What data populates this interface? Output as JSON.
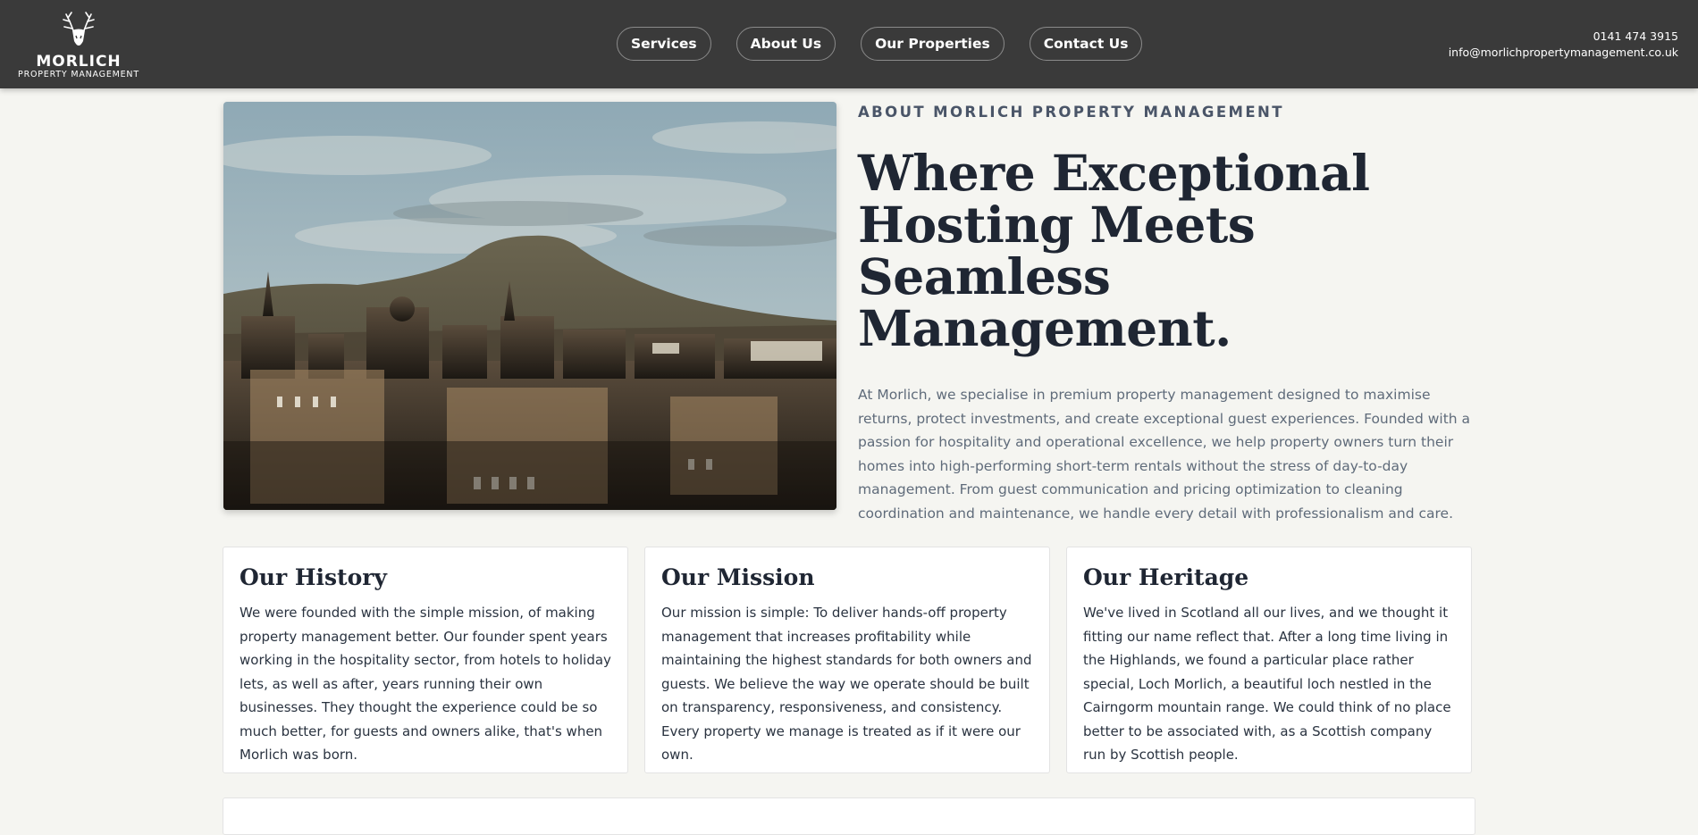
{
  "brand": {
    "name": "MORLICH",
    "subtitle": "PROPERTY MANAGEMENT"
  },
  "nav": {
    "items": [
      "Services",
      "About Us",
      "Our Properties",
      "Contact Us"
    ]
  },
  "contact": {
    "phone": "0141 474 3915",
    "email": "info@morlichpropertymanagement.co.uk"
  },
  "hero": {
    "image_alt": "Edinburgh skyline with Arthur's Seat",
    "eyebrow": "ABOUT MORLICH PROPERTY MANAGEMENT",
    "headline_line1": "Where Exceptional",
    "headline_line2": "Hosting Meets",
    "headline_line3": "Seamless Management.",
    "intro": "At Morlich, we specialise in premium property management designed to maximise returns, protect investments, and create exceptional guest experiences. Founded with a passion for hospitality and operational excellence, we help property owners turn their homes into high-performing short-term rentals without the stress of day-to-day management. From guest communication and pricing optimization to cleaning coordination and maintenance, we handle every detail with professionalism and care."
  },
  "cards": [
    {
      "title": "Our History",
      "body": "We were founded with the simple mission, of making property management better. Our founder spent years working in the hospitality sector, from hotels to holiday lets, as well as after, years running their own businesses. They thought the experience could be so much better, for guests and owners alike, that's when Morlich was born."
    },
    {
      "title": "Our Mission",
      "body": "Our mission is simple: To deliver hands-off property management that increases profitability while maintaining the highest standards for both owners and guests. We believe the way we operate should be built on transparency, responsiveness, and consistency. Every property we manage is treated as if it were our own."
    },
    {
      "title": "Our Heritage",
      "body": "We've lived in Scotland all our lives, and we thought it fitting our name reflect that. After a long time living in the Highlands, we found a particular place rather special, Loch Morlich, a beautiful loch nestled in the Cairngorm mountain range. We could think of no place better to be associated with, as a Scottish company run by Scottish people."
    }
  ],
  "colors": {
    "header_bg": "#3a3a3a",
    "page_bg": "#f5f5f1",
    "heading": "#1f2633",
    "eyebrow": "#4a5568",
    "body_muted": "#5f6b7a"
  }
}
